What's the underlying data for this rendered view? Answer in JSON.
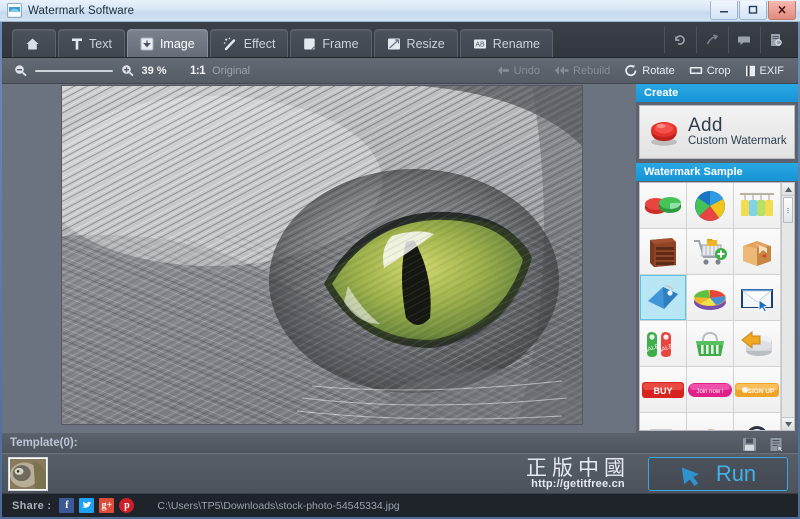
{
  "window": {
    "title": "Watermark Software",
    "icon": "app-image-icon",
    "controls": [
      {
        "name": "minimize",
        "glyph": "minimize-icon"
      },
      {
        "name": "maximize",
        "glyph": "maximize-icon"
      },
      {
        "name": "close",
        "glyph": "close-icon"
      }
    ]
  },
  "tabs": [
    {
      "id": "home",
      "label": "",
      "icon": "home-icon",
      "active": false
    },
    {
      "id": "text",
      "label": "Text",
      "icon": "text-t-icon",
      "active": false
    },
    {
      "id": "image",
      "label": "Image",
      "icon": "image-icon",
      "active": true
    },
    {
      "id": "effect",
      "label": "Effect",
      "icon": "magic-wand-icon",
      "active": false
    },
    {
      "id": "frame",
      "label": "Frame",
      "icon": "frame-icon",
      "active": false
    },
    {
      "id": "resize",
      "label": "Resize",
      "icon": "resize-icon",
      "active": false
    },
    {
      "id": "rename",
      "label": "Rename",
      "icon": "rename-icon",
      "active": false
    }
  ],
  "titlebar_tools": [
    {
      "name": "undo-history-icon",
      "label": "undo-arrow"
    },
    {
      "name": "redo-share-icon",
      "label": "forward-arrow"
    },
    {
      "name": "comment-icon",
      "label": "speech-bubble"
    },
    {
      "name": "register-icon",
      "label": "document-search"
    }
  ],
  "toolbar": {
    "zoom_out_icon": "zoom-out-icon",
    "zoom_in_icon": "zoom-in-icon",
    "zoom_percent": "39 %",
    "one_to_one": "1:1",
    "original_label": "Original",
    "buttons": [
      {
        "id": "undo",
        "label": "Undo",
        "icon": "undo-icon",
        "enabled": false
      },
      {
        "id": "rebuild",
        "label": "Rebuild",
        "icon": "rebuild-icon",
        "enabled": false
      },
      {
        "id": "rotate",
        "label": "Rotate",
        "icon": "rotate-icon",
        "enabled": true
      },
      {
        "id": "crop",
        "label": "Crop",
        "icon": "crop-icon",
        "enabled": true
      },
      {
        "id": "exif",
        "label": "EXIF",
        "icon": "exif-icon",
        "enabled": true
      }
    ]
  },
  "canvas": {
    "image_name": "cat-eye-grayscale-photo",
    "alt": "Close-up grayscale photo of a cat with a green eye"
  },
  "right_panel": {
    "create_header": "Create",
    "add_title": "Add",
    "add_subtitle": "Custom Watermark",
    "add_icon": "red-stamp-button-icon",
    "sample_header": "Watermark Sample",
    "samples": [
      {
        "id": "s1",
        "name": "pie-chart-3d-red-green-icon",
        "selected": false
      },
      {
        "id": "s2",
        "name": "pie-chart-blue-icon",
        "selected": false
      },
      {
        "id": "s3",
        "name": "sale-tags-hanging-icon",
        "selected": false
      },
      {
        "id": "s4",
        "name": "server-rack-icon",
        "selected": false
      },
      {
        "id": "s5",
        "name": "shopping-cart-add-icon",
        "selected": false
      },
      {
        "id": "s6",
        "name": "cardboard-box-icon",
        "selected": false
      },
      {
        "id": "s7",
        "name": "blue-price-tag-icon",
        "selected": true
      },
      {
        "id": "s8",
        "name": "pie-chart-colorful-icon",
        "selected": false
      },
      {
        "id": "s9",
        "name": "envelope-mail-cursor-icon",
        "selected": false
      },
      {
        "id": "s10",
        "name": "sale-door-tags-icon",
        "selected": false
      },
      {
        "id": "s11",
        "name": "shopping-basket-green-icon",
        "selected": false
      },
      {
        "id": "s12",
        "name": "database-gold-arrow-icon",
        "selected": false
      },
      {
        "id": "s13",
        "name": "buy-button-red",
        "label": "BUY",
        "selected": false
      },
      {
        "id": "s14",
        "name": "join-now-button-pink",
        "label": "Join now !",
        "selected": false
      },
      {
        "id": "s15",
        "name": "sign-up-button-orange",
        "label": "SIGN UP",
        "selected": false
      },
      {
        "id": "s16",
        "name": "camera-icon",
        "selected": false
      },
      {
        "id": "s17",
        "name": "hand-icon",
        "selected": false
      },
      {
        "id": "s18",
        "name": "eye-ball-icon",
        "selected": false
      }
    ],
    "scrollbar": {
      "up_icon": "scroll-up-icon",
      "down_icon": "scroll-down-icon"
    }
  },
  "bottom": {
    "template_label": "Template(0):",
    "thumbnail_name": "cat-photo-thumbnail",
    "save_icon": "save-floppy-icon",
    "save_as_icon": "save-as-icon",
    "watermark_cn": "正版中國",
    "watermark_url": "http://getitfree.cn",
    "run_label": "Run",
    "run_icon": "run-arrow-icon"
  },
  "share": {
    "label": "Share :",
    "icons": [
      {
        "name": "facebook-icon",
        "glyph": "f",
        "color": "#3b5998"
      },
      {
        "name": "twitter-icon",
        "glyph": "t",
        "color": "#1da1f2"
      },
      {
        "name": "googleplus-icon",
        "glyph": "g+",
        "color": "#dd4b39"
      },
      {
        "name": "pinterest-icon",
        "glyph": "p",
        "color": "#cb2027"
      }
    ],
    "file_path": "C:\\Users\\TP5\\Downloads\\stock-photo-54545334.jpg"
  },
  "colors": {
    "accent_blue": "#1e9fe0",
    "run_blue": "#3fb2ea",
    "panel_bg": "#5c636e",
    "canvas_bg": "#6b7280",
    "dark_bar": "#1f232a"
  }
}
